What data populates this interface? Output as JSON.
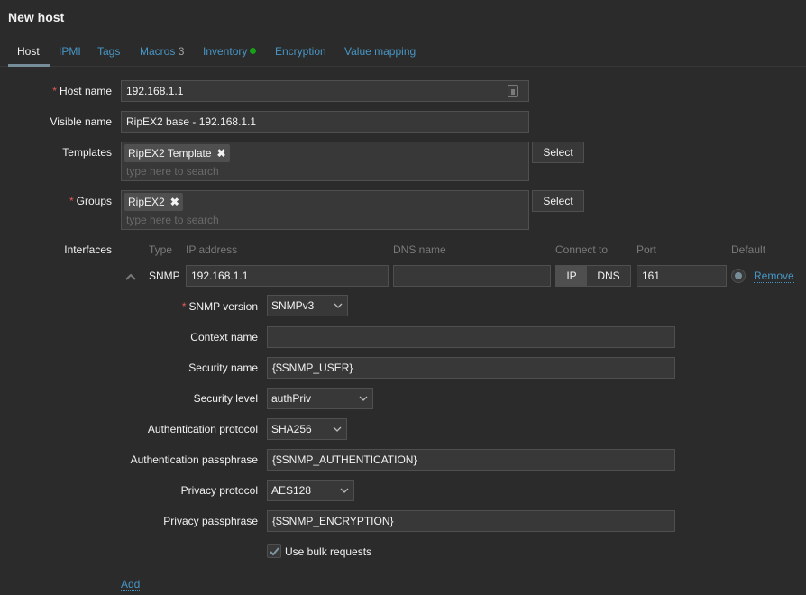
{
  "page": {
    "title": "New host"
  },
  "tabs": [
    {
      "label": "Host",
      "active": true
    },
    {
      "label": "IPMI"
    },
    {
      "label": "Tags"
    },
    {
      "label": "Macros",
      "count": "3"
    },
    {
      "label": "Inventory",
      "indicator": "green-dot"
    },
    {
      "label": "Encryption"
    },
    {
      "label": "Value mapping"
    }
  ],
  "colors": {
    "accent_link": "#4796c4",
    "required": "#e45959",
    "inventory_dot": "#16a116",
    "tab_underline": "#768d99"
  },
  "form": {
    "host_name": {
      "label": "Host name",
      "required": "*",
      "value": "192.168.1.1"
    },
    "visible_name": {
      "label": "Visible name",
      "value": "RipEX2 base - 192.168.1.1"
    },
    "templates": {
      "label": "Templates",
      "chips": [
        "RipEX2 Template"
      ],
      "placeholder": "type here to search",
      "select_label": "Select"
    },
    "groups": {
      "label": "Groups",
      "required": "*",
      "chips": [
        "RipEX2"
      ],
      "placeholder": "type here to search",
      "select_label": "Select"
    },
    "interfaces": {
      "label": "Interfaces",
      "columns": {
        "type": "Type",
        "ip": "IP address",
        "dns": "DNS name",
        "connect": "Connect to",
        "port": "Port",
        "default": "Default"
      },
      "rows": [
        {
          "type": "SNMP",
          "ip": "192.168.1.1",
          "dns": "",
          "connect_options": [
            "IP",
            "DNS"
          ],
          "connect_selected": "IP",
          "port": "161",
          "default": true,
          "remove_label": "Remove",
          "details": {
            "snmp_version": {
              "label": "SNMP version",
              "required": "*",
              "value": "SNMPv3"
            },
            "context_name": {
              "label": "Context name",
              "value": ""
            },
            "security_name": {
              "label": "Security name",
              "value": "{$SNMP_USER}"
            },
            "security_level": {
              "label": "Security level",
              "value": "authPriv"
            },
            "auth_protocol": {
              "label": "Authentication protocol",
              "value": "SHA256"
            },
            "auth_passphrase": {
              "label": "Authentication passphrase",
              "value": "{$SNMP_AUTHENTICATION}"
            },
            "privacy_protocol": {
              "label": "Privacy protocol",
              "value": "AES128"
            },
            "privacy_passphrase": {
              "label": "Privacy passphrase",
              "value": "{$SNMP_ENCRYPTION}"
            },
            "bulk": {
              "label": "Use bulk requests",
              "checked": true
            }
          }
        }
      ],
      "add_label": "Add"
    }
  },
  "icons": {
    "chip_remove": "✖",
    "chevron_down": "⌄",
    "caret_up": "^",
    "checkmark": "✔"
  }
}
